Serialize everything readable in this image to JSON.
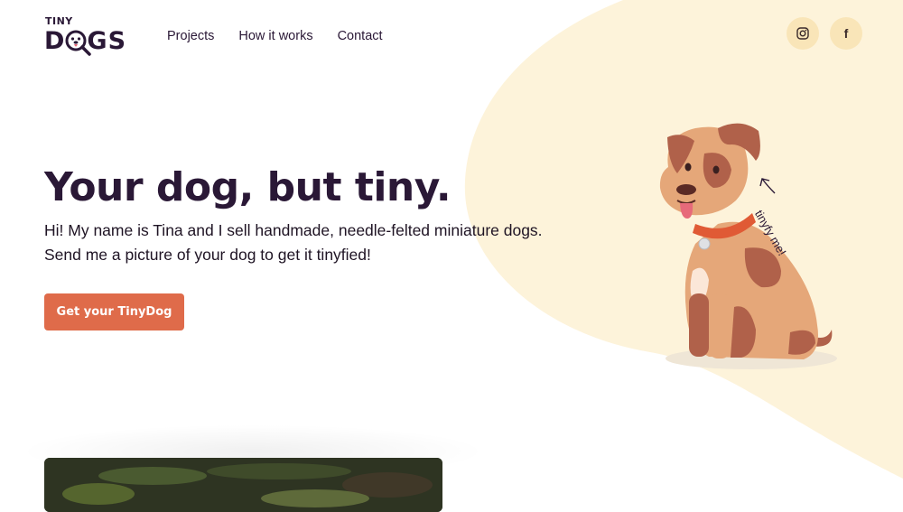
{
  "brand": {
    "logo_top": "TINY",
    "logo_bottom_left": "D",
    "logo_bottom_right": "GS"
  },
  "nav": {
    "items": [
      {
        "label": "Projects"
      },
      {
        "label": "How it works"
      },
      {
        "label": "Contact"
      }
    ]
  },
  "social": {
    "instagram_icon": "instagram-icon",
    "facebook_icon": "facebook-icon",
    "facebook_glyph": "f"
  },
  "hero": {
    "title": "Your dog, but tiny.",
    "intro_line1": "Hi! My name is Tina and I sell handmade, needle-felted miniature dogs.",
    "intro_line2": "Send me a picture of your dog to get it tinyfied!",
    "cta_label": "Get your TinyDog"
  },
  "illustration": {
    "note": "tinyfy me!"
  },
  "colors": {
    "accent": "#df6b4a",
    "blob": "#fdf3da",
    "text": "#2a1836",
    "social_bg": "#f9e5b8"
  }
}
